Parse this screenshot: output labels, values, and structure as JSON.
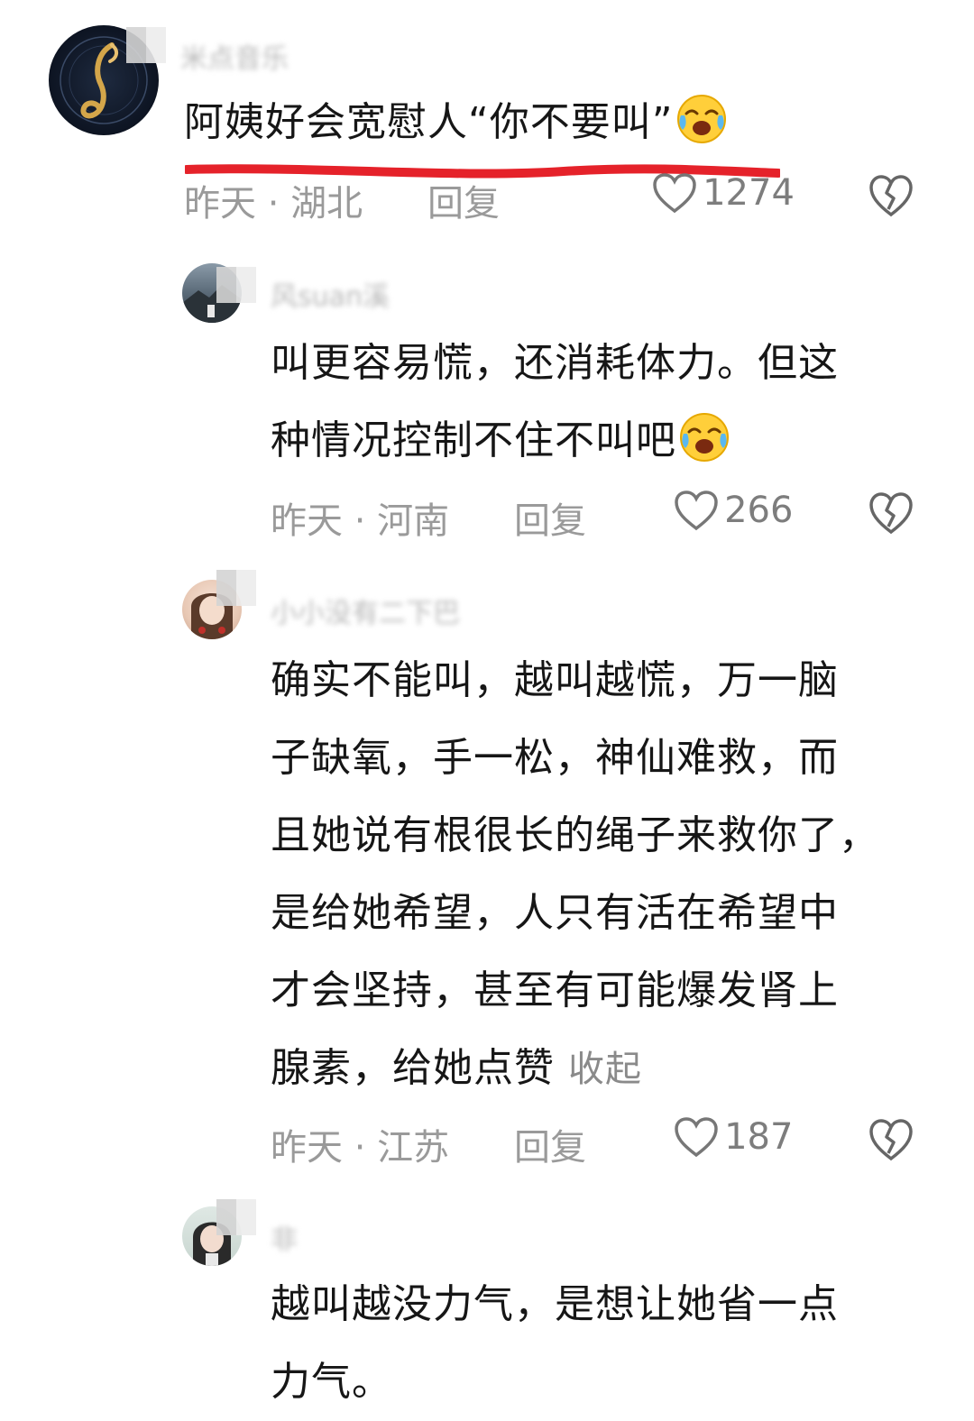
{
  "comments": [
    {
      "username": "米点音乐",
      "text": "阿姨好会宽慰人“你不要叫”",
      "time": "昨天",
      "location": "湖北",
      "reply_label": "回复",
      "likes": "1274",
      "emoji": "crying-laughing-emoji",
      "highlight_color": "#e5222a"
    },
    {
      "username": "风suan溪",
      "text_lines": [
        "叫更容易慌，还消耗体力。但这",
        "种情况控制不住不叫吧"
      ],
      "time": "昨天",
      "location": "河南",
      "reply_label": "回复",
      "likes": "266",
      "emoji": "crying-laughing-emoji"
    },
    {
      "username": "小小没有二下巴",
      "text_lines": [
        "确实不能叫，越叫越慌，万一脑",
        "子缺氧，手一松，神仙难救，而",
        "且她说有根很长的绳子来救你了，",
        "是给她希望，人只有活在希望中",
        "才会坚持，甚至有可能爆发肾上",
        "腺素，给她点赞"
      ],
      "collapse_label": "收起",
      "time": "昨天",
      "location": "江苏",
      "reply_label": "回复",
      "likes": "187"
    },
    {
      "username": "非",
      "text_lines": [
        "越叫越没力气，是想让她省一点",
        "力气。"
      ]
    }
  ],
  "meta_separator": "·",
  "icons": {
    "like": "heart-outline-icon",
    "dislike": "broken-heart-icon"
  }
}
